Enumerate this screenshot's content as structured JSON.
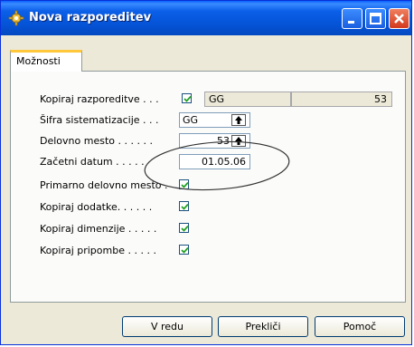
{
  "window": {
    "title": "Nova razporeditev",
    "title_color": "#0553d6"
  },
  "tabs": [
    {
      "label": "Možnosti"
    }
  ],
  "form": {
    "copy_assignments": {
      "label": "Kopiraj razporeditve . . .",
      "checked": true,
      "field1": "GG",
      "field2": "53"
    },
    "system_code": {
      "label": "Šifra sistematizacije . . .",
      "value": "GG"
    },
    "workplace": {
      "label": "Delovno mesto . . . . . .",
      "value": "53"
    },
    "start_date": {
      "label": "Začetni datum . . . . .",
      "value": "01.05.06"
    },
    "primary_workplace": {
      "label": "Primarno delovno mesto .",
      "checked": true
    },
    "copy_allowances": {
      "label": "Kopiraj dodatke. . . . . .",
      "checked": true
    },
    "copy_dimensions": {
      "label": "Kopiraj dimenzije . . . . .",
      "checked": true
    },
    "copy_notes": {
      "label": "Kopiraj pripombe . . . . .",
      "checked": true
    }
  },
  "buttons": {
    "ok": "V redu",
    "cancel": "Prekliči",
    "help": "Pomoč"
  },
  "icons": {
    "window": "gear-icon",
    "lookup": "arrow-up-icon",
    "check": "checkmark-icon"
  }
}
